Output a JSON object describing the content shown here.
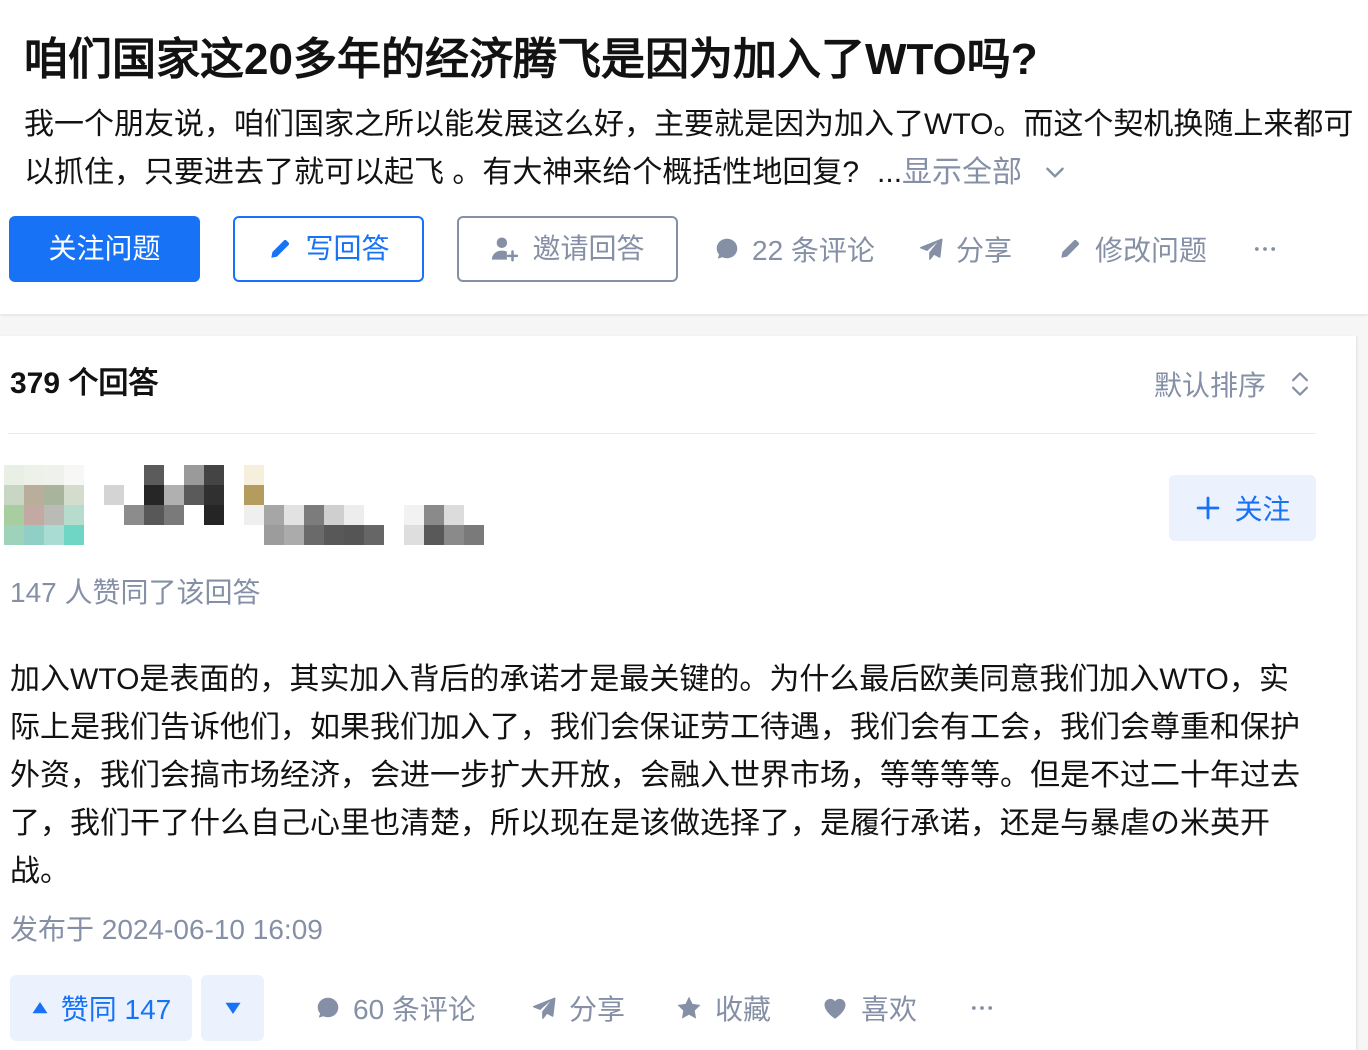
{
  "colors": {
    "primary": "#1772f6",
    "primary_soft": "#ebf2fe",
    "muted": "#8590a6",
    "text": "#121212",
    "page_bg": "#f6f6f6",
    "divider": "#ebebeb"
  },
  "question": {
    "title": "咱们国家这20多年的经济腾飞是因为加入了WTO吗?",
    "description": "我一个朋友说，咱们国家之所以能发展这么好，主要就是因为加入了WTO。而这个契机换随上来都可以抓住，只要进去了就可以起飞 。有大神来给个概括性地回复?",
    "ellipsis": "...",
    "show_all": {
      "label": "显示全部",
      "icon": "chevron-down-icon"
    },
    "actions": {
      "follow": {
        "label": "关注问题"
      },
      "write_answer": {
        "label": "写回答",
        "icon": "pencil-icon"
      },
      "invite": {
        "label": "邀请回答",
        "icon": "invite-user-icon"
      },
      "comments": {
        "label": "22 条评论",
        "icon": "comment-icon"
      },
      "share": {
        "label": "分享",
        "icon": "paper-plane-icon"
      },
      "edit": {
        "label": "修改问题",
        "icon": "pencil-icon"
      },
      "more": {
        "icon": "more-icon"
      }
    }
  },
  "answer_list": {
    "count_label": "379 个回答",
    "sort": {
      "label": "默认排序",
      "icon": "sort-toggle-icon"
    },
    "answers": [
      {
        "author": {
          "avatar_obscured": true,
          "name_obscured": true
        },
        "follow": {
          "label": "关注",
          "icon": "plus-icon"
        },
        "vote_summary": "147 人赞同了该回答",
        "content": "加入WTO是表面的，其实加入背后的承诺才是最关键的。为什么最后欧美同意我们加入WTO，实际上是我们告诉他们，如果我们加入了，我们会保证劳工待遇，我们会有工会，我们会尊重和保护外资，我们会搞市场经济，会进一步扩大开放，会融入世界市场，等等等等。但是不过二十年过去了，我们干了什么自己心里也清楚，所以现在是该做选择了，是履行承诺，还是与暴虐の米英开战。",
        "published": "发布于 2024-06-10 16:09",
        "actions": {
          "upvote": {
            "label": "赞同 147",
            "icon": "triangle-up-icon"
          },
          "downvote": {
            "icon": "triangle-down-icon"
          },
          "comments": {
            "label": "60 条评论",
            "icon": "comment-icon"
          },
          "share": {
            "label": "分享",
            "icon": "paper-plane-icon"
          },
          "collect": {
            "label": "收藏",
            "icon": "star-icon"
          },
          "like": {
            "label": "喜欢",
            "icon": "heart-icon"
          },
          "more": {
            "icon": "more-icon"
          }
        }
      }
    ]
  }
}
